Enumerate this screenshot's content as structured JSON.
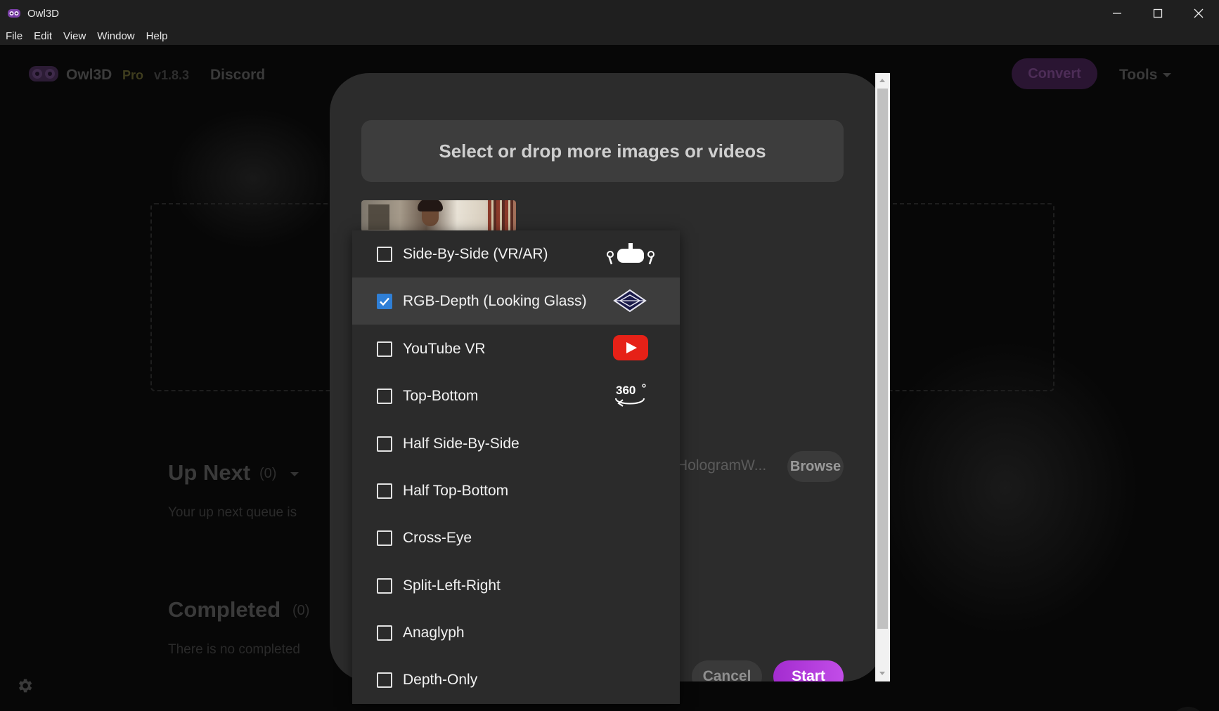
{
  "window": {
    "title": "Owl3D"
  },
  "menu": [
    "File",
    "Edit",
    "View",
    "Window",
    "Help"
  ],
  "header": {
    "brand": "Owl3D",
    "edition": "Pro",
    "version": "v1.8.3",
    "discord": "Discord",
    "convert": "Convert",
    "tools": "Tools"
  },
  "queue": {
    "up_next_title": "Up Next",
    "up_next_count": "(0)",
    "up_next_empty": "Your up next queue is",
    "completed_title": "Completed",
    "completed_count": "(0)",
    "completed_empty": "There is no completed"
  },
  "modal": {
    "select_files": "Select or drop more images or videos",
    "output_path": "HologramW...",
    "browse": "Browse",
    "cancel": "Cancel",
    "start": "Start"
  },
  "formats": [
    {
      "label": "Side-By-Side (VR/AR)",
      "checked": false,
      "icon": "vr-headset-icon"
    },
    {
      "label": "RGB-Depth (Looking Glass)",
      "checked": true,
      "icon": "looking-glass-icon"
    },
    {
      "label": "YouTube VR",
      "checked": false,
      "icon": "youtube-icon"
    },
    {
      "label": "Top-Bottom",
      "checked": false,
      "icon": "360-icon"
    },
    {
      "label": "Half Side-By-Side",
      "checked": false,
      "icon": ""
    },
    {
      "label": "Half Top-Bottom",
      "checked": false,
      "icon": ""
    },
    {
      "label": "Cross-Eye",
      "checked": false,
      "icon": ""
    },
    {
      "label": "Split-Left-Right",
      "checked": false,
      "icon": ""
    },
    {
      "label": "Anaglyph",
      "checked": false,
      "icon": ""
    },
    {
      "label": "Depth-Only",
      "checked": false,
      "icon": ""
    }
  ],
  "icons": {
    "three_sixty_text": "360"
  },
  "colors": {
    "accent_start": "#a32ccf",
    "checkbox_checked": "#2f7fd6",
    "youtube_red": "#e62117"
  }
}
